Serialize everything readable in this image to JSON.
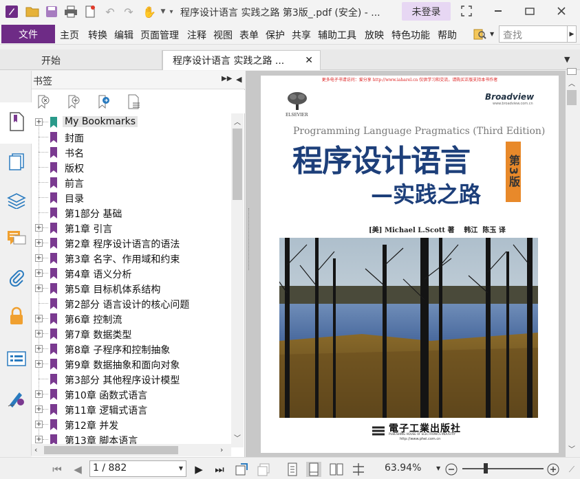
{
  "window": {
    "title": "程序设计语言 实践之路 第3版_.pdf (安全) - ...",
    "login_label": "未登录"
  },
  "menu": {
    "file_label": "文件",
    "items": [
      "主页",
      "转换",
      "编辑",
      "页面管理",
      "注释",
      "视图",
      "表单",
      "保护",
      "共享",
      "辅助工具",
      "放映",
      "特色功能",
      "帮助"
    ],
    "search_placeholder": "查找"
  },
  "tabs": [
    {
      "label": "开始"
    },
    {
      "label": "程序设计语言 实践之路 ..."
    }
  ],
  "bookmarks": {
    "panel_title": "书签",
    "root_label": "My Bookmarks",
    "items": [
      {
        "label": "封面",
        "expandable": false
      },
      {
        "label": "书名",
        "expandable": false
      },
      {
        "label": "版权",
        "expandable": false
      },
      {
        "label": "前言",
        "expandable": false
      },
      {
        "label": "目录",
        "expandable": false
      },
      {
        "label": "第1部分  基础",
        "expandable": false
      },
      {
        "label": "第1章  引言",
        "expandable": true
      },
      {
        "label": "第2章  程序设计语言的语法",
        "expandable": true
      },
      {
        "label": "第3章  名字、作用域和约束",
        "expandable": true
      },
      {
        "label": "第4章  语义分析",
        "expandable": true
      },
      {
        "label": "第5章  目标机体系结构",
        "expandable": true
      },
      {
        "label": "第2部分  语言设计的核心问题",
        "expandable": false
      },
      {
        "label": "第6章  控制流",
        "expandable": true
      },
      {
        "label": "第7章  数据类型",
        "expandable": true
      },
      {
        "label": "第8章  子程序和控制抽象",
        "expandable": true
      },
      {
        "label": "第9章  数据抽象和面向对象",
        "expandable": true
      },
      {
        "label": "第3部分  其他程序设计模型",
        "expandable": false
      },
      {
        "label": "第10章  函数式语言",
        "expandable": true
      },
      {
        "label": "第11章  逻辑式语言",
        "expandable": true
      },
      {
        "label": "第12章  并发",
        "expandable": true
      },
      {
        "label": "第13章  脚本语言",
        "expandable": true
      }
    ]
  },
  "cover": {
    "top_notice": "更多电子书请访问：爱分享 http://www.iaharel.cn  仅供学习和交流，请购买正版支持本书作者",
    "publisher_logo": "ELSEVIER",
    "imprint_logo": "Broadview",
    "imprint_url": "www.broadview.com.cn",
    "english_title": "Programming Language Pragmatics (Third Edition)",
    "main_title": "程序设计语言",
    "sub_title": "—实践之路",
    "edition_badge": "第3版",
    "authors": "[美] Michael L.Scott 著    韩江  陈玉 译",
    "press_name": "電子工業出版社",
    "press_english": "PUBLISHING HOUSE OF ELECTRONICS INDUSTRY",
    "press_url": "http://www.phei.com.cn"
  },
  "status": {
    "page_display": "1 / 882",
    "zoom_display": "63.94%",
    "zoom_fraction": 0.29
  },
  "colors": {
    "accent_purple": "#6e2b86",
    "bookmark_purple": "#7a3a90",
    "bookmark_teal": "#2a9a8a",
    "title_blue": "#1d3f7a",
    "badge_orange": "#e8892a"
  }
}
